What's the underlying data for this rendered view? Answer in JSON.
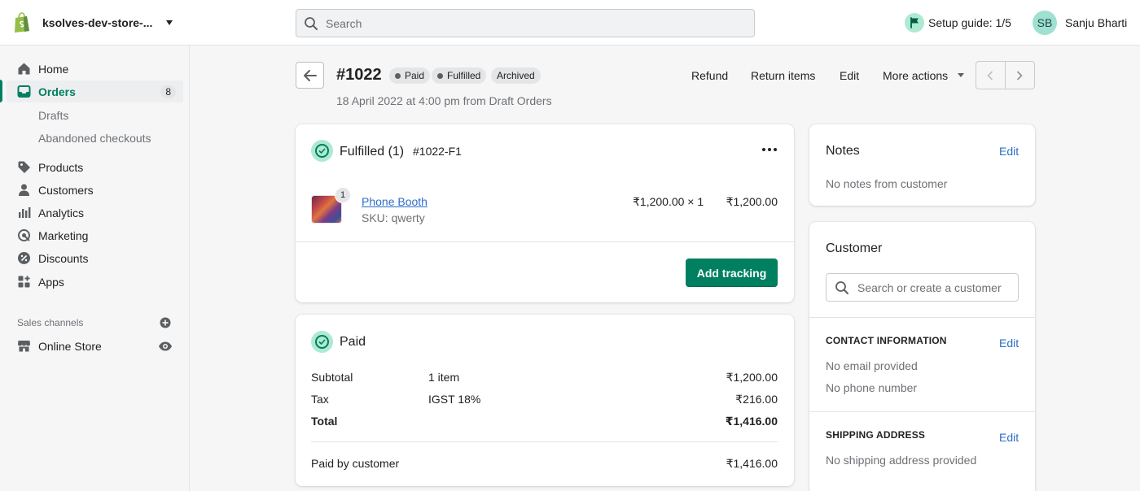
{
  "topbar": {
    "store_name": "ksolves-dev-store-...",
    "search_placeholder": "Search",
    "setup_guide": "Setup guide: 1/5",
    "user_initials": "SB",
    "user_name": "Sanju Bharti"
  },
  "sidebar": {
    "items": [
      {
        "label": "Home",
        "icon": "home-icon"
      },
      {
        "label": "Orders",
        "icon": "orders-icon",
        "badge": "8",
        "active": true
      },
      {
        "label": "Drafts"
      },
      {
        "label": "Abandoned checkouts"
      },
      {
        "label": "Products",
        "icon": "tag-icon"
      },
      {
        "label": "Customers",
        "icon": "person-icon"
      },
      {
        "label": "Analytics",
        "icon": "bar-chart-icon"
      },
      {
        "label": "Marketing",
        "icon": "target-icon"
      },
      {
        "label": "Discounts",
        "icon": "discount-icon"
      },
      {
        "label": "Apps",
        "icon": "apps-icon"
      }
    ],
    "sales_channels_title": "Sales channels",
    "online_store": "Online Store"
  },
  "header": {
    "order_number": "#1022",
    "badges": [
      "Paid",
      "Fulfilled",
      "Archived"
    ],
    "subtitle": "18 April 2022 at 4:00 pm from Draft Orders",
    "actions": [
      "Refund",
      "Return items",
      "Edit",
      "More actions"
    ]
  },
  "fulfilled_card": {
    "title": "Fulfilled (1)",
    "fulfillment_id": "#1022-F1",
    "item": {
      "name": "Phone Booth",
      "sku": "SKU: qwerty",
      "quantity_badge": "1",
      "price_qty": "₹1,200.00 × 1",
      "total": "₹1,200.00"
    },
    "add_tracking": "Add tracking"
  },
  "paid_card": {
    "title": "Paid",
    "rows": [
      {
        "label": "Subtotal",
        "detail": "1 item",
        "amount": "₹1,200.00"
      },
      {
        "label": "Tax",
        "detail": "IGST 18%",
        "amount": "₹216.00"
      },
      {
        "label": "Total",
        "detail": "",
        "amount": "₹1,416.00"
      }
    ],
    "paid_by_label": "Paid by customer",
    "paid_by_amount": "₹1,416.00"
  },
  "notes_card": {
    "title": "Notes",
    "edit": "Edit",
    "text": "No notes from customer"
  },
  "customer_card": {
    "title": "Customer",
    "search_placeholder": "Search or create a customer",
    "contact_title": "CONTACT INFORMATION",
    "contact_edit": "Edit",
    "no_email": "No email provided",
    "no_phone": "No phone number",
    "shipping_title": "SHIPPING ADDRESS",
    "shipping_edit": "Edit",
    "no_shipping": "No shipping address provided"
  },
  "colors": {
    "primary_green": "#008060",
    "link_blue": "#2c6ecb",
    "success_circle": "#aee9d1"
  }
}
